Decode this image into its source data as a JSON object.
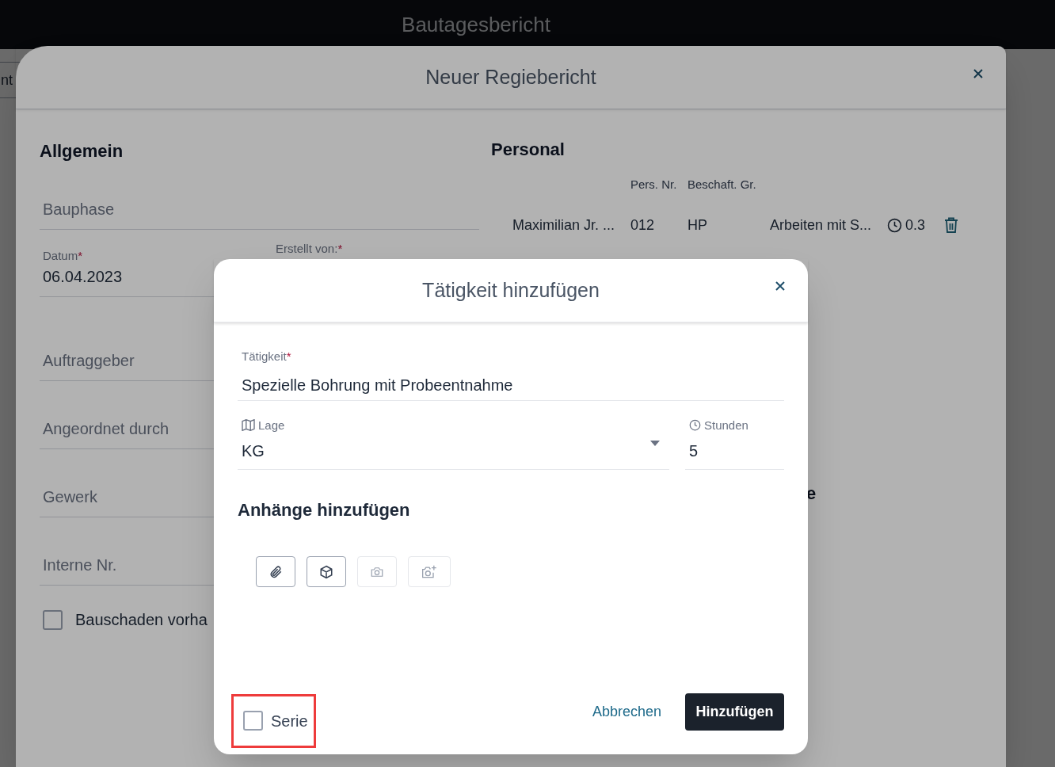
{
  "app_bar": {
    "title": "Bautagesbericht"
  },
  "background_toolbar": {
    "label": "nt"
  },
  "report_dialog": {
    "title": "Neuer Regiebericht",
    "general": {
      "heading": "Allgemein",
      "fields": [
        {
          "kind": "placeholder",
          "label": "Bauphase"
        },
        {
          "kind": "pair",
          "left": {
            "label": "Datum",
            "required_mark": "*",
            "value": "06.04.2023"
          },
          "right": {
            "label": "Erstellt von:",
            "required_mark": "*"
          }
        },
        {
          "kind": "placeholder",
          "label": "Auftraggeber"
        },
        {
          "kind": "placeholder",
          "label": "Angeordnet durch"
        },
        {
          "kind": "placeholder",
          "label": "Gewerk"
        },
        {
          "kind": "placeholder",
          "label": "Interne Nr."
        }
      ],
      "checkbox": {
        "label": "Bauschaden vorha",
        "checked": false
      }
    },
    "personal": {
      "heading": "Personal",
      "columns": [
        "Pers. Nr.",
        "Beschaft. Gr."
      ],
      "rows": [
        {
          "name": "Maximilian Jr. ...",
          "pers_nr": "012",
          "group": "HP",
          "activity": "Arbeiten mit S...",
          "hours": "0.3"
        }
      ]
    },
    "hidden_heading_fragment": "e"
  },
  "activity_dialog": {
    "title": "Tätigkeit hinzufügen",
    "activity": {
      "label": "Tätigkeit",
      "required_mark": "*",
      "value": "Spezielle Bohrung mit Probeentnahme"
    },
    "location": {
      "label": "Lage",
      "value": "KG"
    },
    "hours": {
      "label": "Stunden",
      "value": "5"
    },
    "attachments_heading": "Anhänge hinzufügen",
    "attachment_buttons": [
      {
        "kind": "paperclip",
        "disabled": false
      },
      {
        "kind": "cube",
        "disabled": false
      },
      {
        "kind": "camera",
        "disabled": true
      },
      {
        "kind": "camera-plus",
        "disabled": true
      }
    ],
    "series": {
      "label": "Serie",
      "checked": false,
      "highlighted": true
    },
    "cancel": "Abbrechen",
    "submit": "Hinzufügen"
  }
}
